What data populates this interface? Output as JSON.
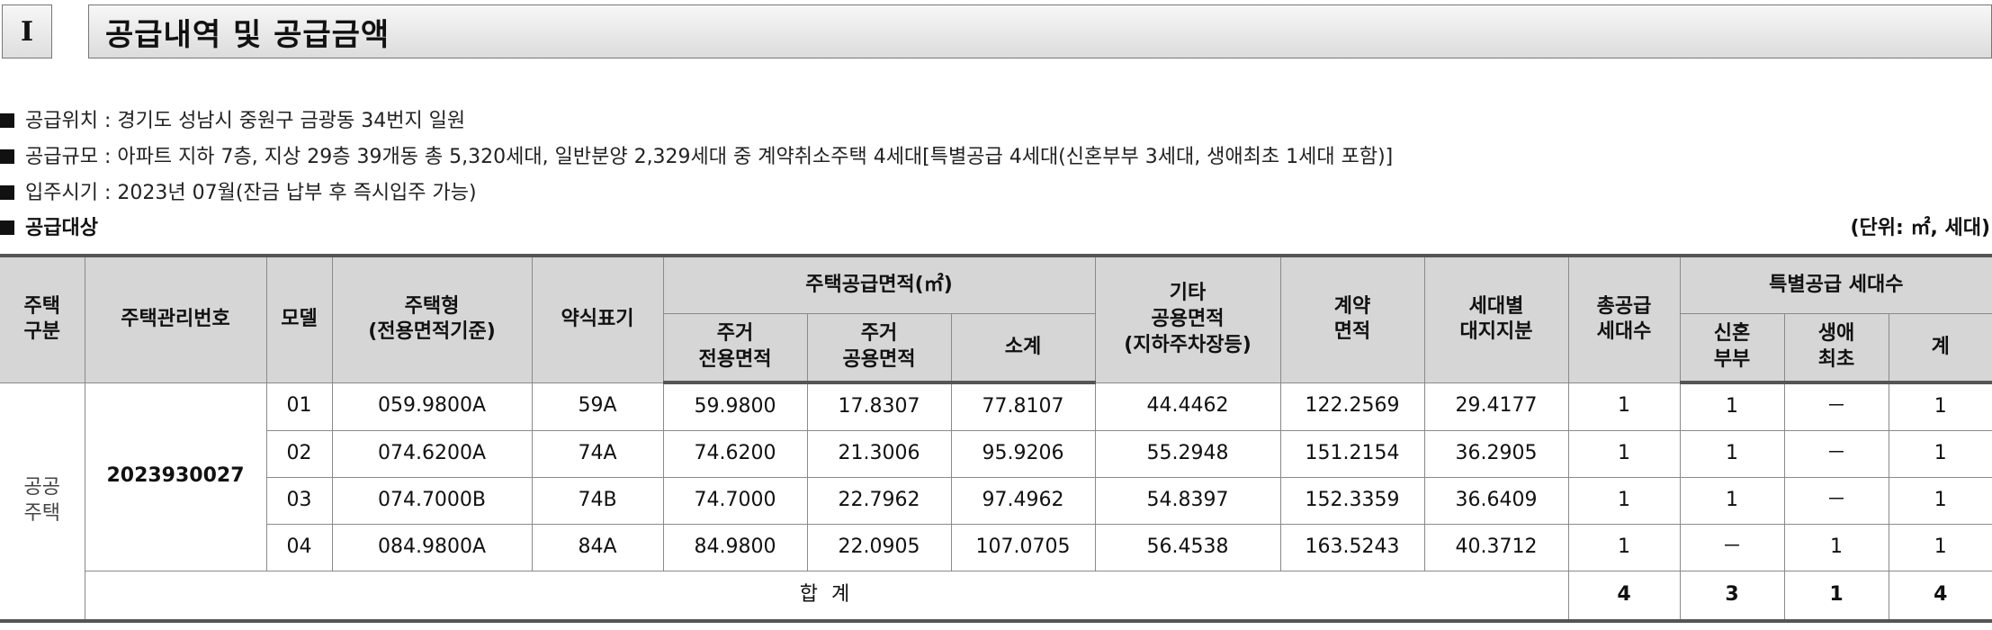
{
  "header": {
    "roman": "I",
    "title": "공급내역 및 공급금액"
  },
  "info": [
    "공급위치 : 경기도 성남시 중원구 금광동 34번지 일원",
    "공급규모 : 아파트 지하 7층, 지상 29층 39개동 총 5,320세대, 일반분양 2,329세대 중 계약취소주택 4세대[특별공급 4세대(신혼부부 3세대, 생애최초 1세대 포함)]",
    "입주시기 : 2023년 07월(잔금 납부 후 즉시입주 가능)"
  ],
  "target": "공급대상",
  "unit": "(단위: ㎡, 세대)",
  "table": {
    "headers": {
      "type_group": [
        "주택",
        "구분"
      ],
      "mgmt_no": "주택관리번호",
      "model": "모델",
      "housing_type": [
        "주택형",
        "(전용면적기준)"
      ],
      "abbr": "약식표기",
      "supply_area": "주택공급면적(㎡)",
      "residential_exclusive": [
        "주거",
        "전용면적"
      ],
      "residential_common": [
        "주거",
        "공용면적"
      ],
      "subtotal": "소계",
      "other_common": [
        "기타",
        "공용면적",
        "(지하주차장등)"
      ],
      "contract_area": [
        "계약",
        "면적"
      ],
      "land_share": [
        "세대별",
        "대지지분"
      ],
      "total_units": [
        "총공급",
        "세대수"
      ],
      "special": "특별공급 세대수",
      "newlywed": [
        "신혼",
        "부부"
      ],
      "first_time": [
        "생애",
        "최초"
      ],
      "special_total": "계"
    },
    "group": [
      "공공",
      "주택"
    ],
    "mgmt_number": "2023930027",
    "rows": [
      {
        "model": "01",
        "type": "059.9800A",
        "abbr": "59A",
        "excl": "59.9800",
        "common": "17.8307",
        "sub": "77.8107",
        "other": "44.4462",
        "contract": "122.2569",
        "land": "29.4177",
        "total": "1",
        "newlywed": "1",
        "first": "－",
        "sp_total": "1"
      },
      {
        "model": "02",
        "type": "074.6200A",
        "abbr": "74A",
        "excl": "74.6200",
        "common": "21.3006",
        "sub": "95.9206",
        "other": "55.2948",
        "contract": "151.2154",
        "land": "36.2905",
        "total": "1",
        "newlywed": "1",
        "first": "－",
        "sp_total": "1"
      },
      {
        "model": "03",
        "type": "074.7000B",
        "abbr": "74B",
        "excl": "74.7000",
        "common": "22.7962",
        "sub": "97.4962",
        "other": "54.8397",
        "contract": "152.3359",
        "land": "36.6409",
        "total": "1",
        "newlywed": "1",
        "first": "－",
        "sp_total": "1"
      },
      {
        "model": "04",
        "type": "084.9800A",
        "abbr": "84A",
        "excl": "84.9800",
        "common": "22.0905",
        "sub": "107.0705",
        "other": "56.4538",
        "contract": "163.5243",
        "land": "40.3712",
        "total": "1",
        "newlywed": "－",
        "first": "1",
        "sp_total": "1"
      }
    ],
    "sum": {
      "label": "합 계",
      "total": "4",
      "newlywed": "3",
      "first": "1",
      "sp_total": "4"
    }
  }
}
